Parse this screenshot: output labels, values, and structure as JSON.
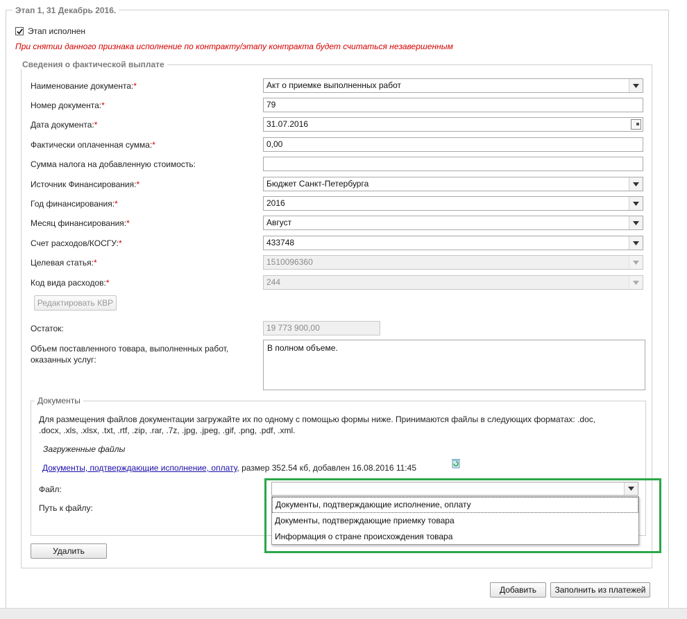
{
  "stage": {
    "legend": "Этап 1, 31 Декабрь 2016.",
    "completed_label": "Этап исполнен",
    "completed_checked": true,
    "warning": "При снятии данного признака исполнение по контракту/этапу контракта будет считаться незавершенным"
  },
  "payment": {
    "legend": "Сведения о фактической выплате",
    "required_mark": "*",
    "fields": [
      {
        "label": "Наименование документа:",
        "required": true,
        "value": "Акт о приемке выполненных работ"
      },
      {
        "label": "Номер документа:",
        "required": true,
        "value": "79"
      },
      {
        "label": "Дата документа:",
        "required": true,
        "value": "31.07.2016"
      },
      {
        "label": "Фактически оплаченная сумма:",
        "required": true,
        "value": "0,00"
      },
      {
        "label": "Сумма налога на добавленную стоимость:",
        "required": false,
        "value": ""
      },
      {
        "label": "Источник Финансирования:",
        "required": true,
        "value": "Бюджет Санкт-Петербурга"
      },
      {
        "label": "Год финансирования:",
        "required": true,
        "value": "2016"
      },
      {
        "label": "Месяц финансирования:",
        "required": true,
        "value": "Август"
      },
      {
        "label": "Счет расходов/КОСГУ:",
        "required": true,
        "value": "433748"
      },
      {
        "label": "Целевая статья:",
        "required": true,
        "value": "1510096360"
      },
      {
        "label": "Код вида расходов:",
        "required": true,
        "value": "244"
      }
    ],
    "edit_kvr_button": "Редактировать КВР",
    "remainder_label": "Остаток:",
    "remainder_value": "19 773 900,00",
    "volume_label_line1": "Объем поставленного товара, выполненных работ,",
    "volume_label_line2": "оказанных услуг:",
    "volume_value": "В полном объеме."
  },
  "documents": {
    "legend": "Документы",
    "info_line1": "Для размещения файлов документации загружайте их по одному с помощью формы ниже. Принимаются файлы в следующих форматах: .doc,",
    "info_line2": ".docx, .xls, .xlsx, .txt, .rtf, .zip, .rar, .7z, .jpg, .jpeg, .gif, .png, .pdf, .xml.",
    "uploaded_heading": "Загруженные файлы",
    "uploaded_link": "Документы, подтверждающие исполнение, оплату",
    "uploaded_meta": ", размер 352.54 кб, добавлен 16.08.2016 11:45",
    "file_label": "Файл:",
    "path_label": "Путь к файлу:",
    "file_select_value": "",
    "options": [
      "Документы, подтверждающие исполнение, оплату",
      "Документы, подтверждающие приемку товара",
      "Информация о стране происхождения товара"
    ]
  },
  "buttons": {
    "delete": "Удалить",
    "add": "Добавить",
    "fill_from_payments": "Заполнить из платежей"
  },
  "colors": {
    "required": "#d40000",
    "warning": "#d40000",
    "link": "#1a0dab",
    "highlight": "#2aa748"
  }
}
